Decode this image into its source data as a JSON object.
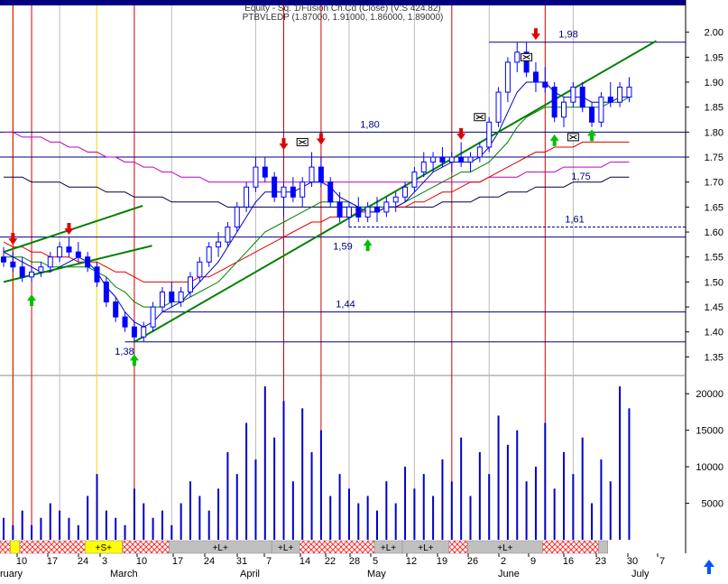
{
  "header": {
    "title_lines": [
      "Equity - Sq. 1/Fusion Ch.Cd (Close) (V:S 424.82)",
      "PTBVLEDP (1.87000, 1.91000, 1.86000, 1.89000)"
    ]
  },
  "chart_data": {
    "type": "candlestick",
    "colors": {
      "up": "#ffffff",
      "down": "#0000ff",
      "outline": "#0000ff",
      "volume": "#0000cc",
      "ma_short": "#0000cc",
      "ma_mid": "#008000",
      "ma_long": "#e00000",
      "ma_200": "#c000c0",
      "ma_300": "#000040",
      "trend": "#008000",
      "level": "#000080",
      "event_line": "#d00000",
      "gray_line": "#bbbbbb",
      "yellow_line": "#ffd000"
    },
    "price_axis": {
      "ticks": [
        "2.00",
        "1.95",
        "1.90",
        "1.85",
        "1.80",
        "1.75",
        "1.70",
        "1.65",
        "1.60",
        "1.55",
        "1.50",
        "1.45",
        "1.40",
        "1.35"
      ],
      "ylim": [
        1.32,
        2.05
      ]
    },
    "volume_axis": {
      "ticks": [
        "20000",
        "15000",
        "10000",
        "5000"
      ],
      "ylim": [
        0,
        22000
      ]
    },
    "x_day_labels": [
      "10",
      "17",
      "24",
      "3",
      "10",
      "17",
      "24",
      "31",
      "7",
      "14",
      "22",
      "28",
      "5",
      "12",
      "19",
      "26",
      "2",
      "9",
      "16",
      "23",
      "30",
      "7"
    ],
    "x_month_labels": [
      "ruary",
      "March",
      "April",
      "May",
      "June",
      "July"
    ],
    "candles": [
      [
        1.55,
        1.57,
        1.53,
        1.54
      ],
      [
        1.54,
        1.56,
        1.52,
        1.53
      ],
      [
        1.53,
        1.55,
        1.5,
        1.51
      ],
      [
        1.51,
        1.53,
        1.5,
        1.52
      ],
      [
        1.52,
        1.54,
        1.51,
        1.53
      ],
      [
        1.53,
        1.56,
        1.52,
        1.55
      ],
      [
        1.55,
        1.58,
        1.54,
        1.57
      ],
      [
        1.57,
        1.59,
        1.55,
        1.56
      ],
      [
        1.56,
        1.58,
        1.54,
        1.55
      ],
      [
        1.55,
        1.56,
        1.52,
        1.53
      ],
      [
        1.53,
        1.54,
        1.49,
        1.5
      ],
      [
        1.5,
        1.51,
        1.45,
        1.46
      ],
      [
        1.46,
        1.47,
        1.42,
        1.43
      ],
      [
        1.43,
        1.44,
        1.4,
        1.41
      ],
      [
        1.41,
        1.42,
        1.38,
        1.39
      ],
      [
        1.39,
        1.42,
        1.38,
        1.41
      ],
      [
        1.41,
        1.46,
        1.4,
        1.45
      ],
      [
        1.45,
        1.49,
        1.44,
        1.48
      ],
      [
        1.48,
        1.5,
        1.45,
        1.46
      ],
      [
        1.46,
        1.49,
        1.45,
        1.48
      ],
      [
        1.48,
        1.52,
        1.47,
        1.51
      ],
      [
        1.51,
        1.55,
        1.5,
        1.54
      ],
      [
        1.54,
        1.58,
        1.53,
        1.57
      ],
      [
        1.57,
        1.6,
        1.55,
        1.58
      ],
      [
        1.58,
        1.62,
        1.57,
        1.61
      ],
      [
        1.61,
        1.66,
        1.6,
        1.65
      ],
      [
        1.65,
        1.7,
        1.64,
        1.69
      ],
      [
        1.69,
        1.75,
        1.68,
        1.73
      ],
      [
        1.73,
        1.75,
        1.7,
        1.71
      ],
      [
        1.71,
        1.72,
        1.66,
        1.67
      ],
      [
        1.67,
        1.7,
        1.63,
        1.69
      ],
      [
        1.69,
        1.71,
        1.66,
        1.67
      ],
      [
        1.67,
        1.71,
        1.65,
        1.7
      ],
      [
        1.7,
        1.76,
        1.69,
        1.73
      ],
      [
        1.73,
        1.75,
        1.69,
        1.7
      ],
      [
        1.7,
        1.71,
        1.65,
        1.66
      ],
      [
        1.66,
        1.68,
        1.62,
        1.63
      ],
      [
        1.63,
        1.66,
        1.61,
        1.65
      ],
      [
        1.65,
        1.67,
        1.62,
        1.63
      ],
      [
        1.63,
        1.66,
        1.62,
        1.65
      ],
      [
        1.65,
        1.67,
        1.62,
        1.64
      ],
      [
        1.64,
        1.67,
        1.63,
        1.66
      ],
      [
        1.66,
        1.68,
        1.64,
        1.67
      ],
      [
        1.67,
        1.7,
        1.66,
        1.69
      ],
      [
        1.69,
        1.73,
        1.68,
        1.72
      ],
      [
        1.72,
        1.76,
        1.71,
        1.74
      ],
      [
        1.74,
        1.76,
        1.72,
        1.75
      ],
      [
        1.75,
        1.77,
        1.73,
        1.74
      ],
      [
        1.74,
        1.76,
        1.72,
        1.75
      ],
      [
        1.75,
        1.78,
        1.73,
        1.74
      ],
      [
        1.74,
        1.76,
        1.72,
        1.75
      ],
      [
        1.75,
        1.78,
        1.74,
        1.77
      ],
      [
        1.77,
        1.83,
        1.76,
        1.82
      ],
      [
        1.82,
        1.89,
        1.81,
        1.88
      ],
      [
        1.88,
        1.95,
        1.86,
        1.94
      ],
      [
        1.94,
        1.98,
        1.92,
        1.96
      ],
      [
        1.96,
        1.98,
        1.91,
        1.92
      ],
      [
        1.92,
        1.94,
        1.88,
        1.9
      ],
      [
        1.9,
        1.93,
        1.88,
        1.89
      ],
      [
        1.89,
        1.9,
        1.82,
        1.83
      ],
      [
        1.83,
        1.87,
        1.81,
        1.86
      ],
      [
        1.86,
        1.9,
        1.85,
        1.89
      ],
      [
        1.89,
        1.9,
        1.84,
        1.85
      ],
      [
        1.85,
        1.86,
        1.81,
        1.82
      ],
      [
        1.82,
        1.88,
        1.81,
        1.87
      ],
      [
        1.87,
        1.9,
        1.85,
        1.86
      ],
      [
        1.86,
        1.9,
        1.85,
        1.89
      ],
      [
        1.87,
        1.91,
        1.86,
        1.89
      ]
    ],
    "volumes": [
      3,
      2,
      4,
      2,
      3,
      5,
      4,
      3,
      2,
      6,
      9,
      4,
      3,
      2,
      7,
      5,
      3,
      4,
      2,
      5,
      8,
      6,
      4,
      7,
      12,
      9,
      16,
      11,
      21,
      14,
      19,
      8,
      18,
      12,
      15,
      6,
      9,
      7,
      5,
      6,
      4,
      8,
      5,
      10,
      7,
      9,
      6,
      11,
      8,
      14,
      6,
      12,
      9,
      17,
      13,
      15,
      8,
      10,
      16,
      7,
      12,
      9,
      14,
      5,
      11,
      8,
      21,
      18
    ],
    "moving_averages": {
      "ma_short": [
        1.56,
        1.55,
        1.54,
        1.53,
        1.52,
        1.52,
        1.53,
        1.54,
        1.55,
        1.54,
        1.52,
        1.49,
        1.47,
        1.44,
        1.42,
        1.41,
        1.42,
        1.44,
        1.45,
        1.46,
        1.48,
        1.5,
        1.52,
        1.54,
        1.57,
        1.6,
        1.63,
        1.66,
        1.68,
        1.68,
        1.68,
        1.68,
        1.69,
        1.7,
        1.7,
        1.69,
        1.67,
        1.66,
        1.65,
        1.64,
        1.64,
        1.65,
        1.65,
        1.66,
        1.68,
        1.7,
        1.72,
        1.73,
        1.74,
        1.74,
        1.74,
        1.75,
        1.77,
        1.8,
        1.84,
        1.88,
        1.9,
        1.9,
        1.9,
        1.88,
        1.87,
        1.87,
        1.87,
        1.86,
        1.86,
        1.86,
        1.87,
        1.87
      ],
      "ma_mid": [
        1.55,
        1.55,
        1.55,
        1.54,
        1.54,
        1.53,
        1.53,
        1.53,
        1.53,
        1.53,
        1.52,
        1.51,
        1.49,
        1.48,
        1.46,
        1.45,
        1.45,
        1.45,
        1.46,
        1.46,
        1.47,
        1.48,
        1.49,
        1.5,
        1.52,
        1.54,
        1.56,
        1.58,
        1.6,
        1.61,
        1.62,
        1.63,
        1.64,
        1.65,
        1.66,
        1.66,
        1.66,
        1.66,
        1.65,
        1.65,
        1.65,
        1.65,
        1.65,
        1.66,
        1.67,
        1.68,
        1.69,
        1.7,
        1.71,
        1.72,
        1.72,
        1.73,
        1.74,
        1.76,
        1.78,
        1.81,
        1.83,
        1.84,
        1.85,
        1.85,
        1.85,
        1.85,
        1.85,
        1.85,
        1.85,
        1.86,
        1.86,
        1.87
      ],
      "ma_long": [
        1.58,
        1.57,
        1.57,
        1.56,
        1.56,
        1.55,
        1.55,
        1.55,
        1.54,
        1.54,
        1.54,
        1.53,
        1.52,
        1.52,
        1.51,
        1.5,
        1.5,
        1.5,
        1.5,
        1.5,
        1.5,
        1.51,
        1.51,
        1.52,
        1.53,
        1.54,
        1.55,
        1.56,
        1.57,
        1.58,
        1.59,
        1.6,
        1.61,
        1.62,
        1.62,
        1.63,
        1.63,
        1.63,
        1.64,
        1.64,
        1.64,
        1.65,
        1.65,
        1.65,
        1.66,
        1.66,
        1.67,
        1.68,
        1.68,
        1.69,
        1.7,
        1.7,
        1.71,
        1.72,
        1.73,
        1.74,
        1.75,
        1.76,
        1.76,
        1.77,
        1.77,
        1.77,
        1.78,
        1.78,
        1.78,
        1.78,
        1.78,
        1.78
      ],
      "ma_200": [
        1.8,
        1.8,
        1.79,
        1.79,
        1.79,
        1.78,
        1.78,
        1.77,
        1.77,
        1.76,
        1.76,
        1.75,
        1.75,
        1.74,
        1.74,
        1.73,
        1.73,
        1.72,
        1.72,
        1.71,
        1.71,
        1.71,
        1.7,
        1.7,
        1.7,
        1.7,
        1.7,
        1.7,
        1.7,
        1.7,
        1.7,
        1.7,
        1.7,
        1.7,
        1.7,
        1.7,
        1.7,
        1.7,
        1.7,
        1.7,
        1.7,
        1.7,
        1.7,
        1.7,
        1.7,
        1.7,
        1.7,
        1.7,
        1.7,
        1.7,
        1.7,
        1.7,
        1.71,
        1.71,
        1.71,
        1.71,
        1.72,
        1.72,
        1.72,
        1.72,
        1.73,
        1.73,
        1.73,
        1.73,
        1.73,
        1.74,
        1.74,
        1.74
      ],
      "ma_300": [
        1.71,
        1.71,
        1.71,
        1.7,
        1.7,
        1.7,
        1.7,
        1.69,
        1.69,
        1.69,
        1.69,
        1.68,
        1.68,
        1.68,
        1.67,
        1.67,
        1.67,
        1.67,
        1.66,
        1.66,
        1.66,
        1.66,
        1.66,
        1.66,
        1.65,
        1.65,
        1.65,
        1.65,
        1.65,
        1.65,
        1.65,
        1.65,
        1.65,
        1.65,
        1.65,
        1.65,
        1.65,
        1.65,
        1.65,
        1.65,
        1.65,
        1.65,
        1.65,
        1.65,
        1.65,
        1.65,
        1.65,
        1.66,
        1.66,
        1.66,
        1.66,
        1.67,
        1.67,
        1.67,
        1.68,
        1.68,
        1.68,
        1.69,
        1.69,
        1.69,
        1.69,
        1.7,
        1.7,
        1.7,
        1.7,
        1.71,
        1.71,
        1.71
      ]
    },
    "horizontal_levels": [
      {
        "value": 1.98,
        "label": "1,98",
        "from_index": 52
      },
      {
        "value": 1.8,
        "label": "1,80",
        "from_index": 0
      },
      {
        "value": 1.75,
        "label": "",
        "from_index": 0
      },
      {
        "value": 1.61,
        "label": "1,61",
        "from_index": 37,
        "dashed": true
      },
      {
        "value": 1.59,
        "label": "1,59",
        "from_index": 0
      },
      {
        "value": 1.44,
        "label": "1,44",
        "from_index": 17
      },
      {
        "value": 1.38,
        "label": "1,38",
        "from_index": 13
      }
    ],
    "level_labels": [
      {
        "label": "1,75",
        "value": 1.75,
        "index": 60
      },
      {
        "label": "1,38",
        "value": 1.38,
        "index": 13
      }
    ],
    "trendlines": [
      {
        "from": [
          14,
          1.38
        ],
        "to": [
          67,
          1.95
        ]
      },
      {
        "from": [
          0,
          1.56
        ],
        "to": [
          12,
          1.62
        ]
      },
      {
        "from": [
          0,
          1.5
        ],
        "to": [
          13,
          1.54
        ]
      }
    ],
    "event_lines_red": [
      1,
      3,
      14,
      30,
      34,
      48,
      58
    ],
    "event_lines_gray": [
      6,
      18,
      27,
      37,
      44,
      52,
      61
    ],
    "event_lines_yellow": [
      0,
      9
    ],
    "signals": [
      {
        "type": "sell",
        "index": 1,
        "price": 1.58
      },
      {
        "type": "sell",
        "index": 7,
        "price": 1.6
      },
      {
        "type": "buy",
        "index": 3,
        "price": 1.47
      },
      {
        "type": "buy",
        "index": 14,
        "price": 1.35
      },
      {
        "type": "sell",
        "index": 30,
        "price": 1.77
      },
      {
        "type": "sell",
        "index": 34,
        "price": 1.78
      },
      {
        "type": "buy",
        "index": 39,
        "price": 1.58
      },
      {
        "type": "sell",
        "index": 49,
        "price": 1.79
      },
      {
        "type": "sell",
        "index": 57,
        "price": 1.99
      },
      {
        "type": "buy",
        "index": 59,
        "price": 1.79
      },
      {
        "type": "buy",
        "index": 63,
        "price": 1.8
      }
    ],
    "boxes": [
      {
        "index": 32,
        "price": 1.78
      },
      {
        "index": 51,
        "price": 1.83
      },
      {
        "index": 56,
        "price": 1.95
      },
      {
        "index": 61,
        "price": 1.79
      }
    ],
    "signal_bar": [
      {
        "label": "",
        "color": "#ff4040",
        "pattern": "hatch",
        "from": 0,
        "to": 1
      },
      {
        "label": "",
        "color": "#ffff00",
        "pattern": "solid",
        "from": 1,
        "to": 2
      },
      {
        "label": "",
        "color": "#ff4040",
        "pattern": "hatch",
        "from": 2,
        "to": 9
      },
      {
        "label": "+S+",
        "color": "#ffff00",
        "pattern": "solid",
        "from": 9,
        "to": 13
      },
      {
        "label": "",
        "color": "#ff4040",
        "pattern": "hatch",
        "from": 13,
        "to": 18
      },
      {
        "label": "+L+",
        "color": "#c0c0c0",
        "pattern": "solid",
        "from": 18,
        "to": 29
      },
      {
        "label": "+L+",
        "color": "#c0c0c0",
        "pattern": "solid",
        "from": 29,
        "to": 32
      },
      {
        "label": "",
        "color": "#ff4040",
        "pattern": "hatch",
        "from": 32,
        "to": 40
      },
      {
        "label": "+L+",
        "color": "#c0c0c0",
        "pattern": "solid",
        "from": 40,
        "to": 43
      },
      {
        "label": "+L+",
        "color": "#c0c0c0",
        "pattern": "solid",
        "from": 43,
        "to": 48
      },
      {
        "label": "",
        "color": "#ff4040",
        "pattern": "hatch",
        "from": 48,
        "to": 50
      },
      {
        "label": "+L+",
        "color": "#c0c0c0",
        "pattern": "solid",
        "from": 50,
        "to": 58
      },
      {
        "label": "",
        "color": "#ff4040",
        "pattern": "hatch",
        "from": 58,
        "to": 64
      },
      {
        "label": "",
        "color": "#c0c0c0",
        "pattern": "solid",
        "from": 64,
        "to": 65
      }
    ]
  },
  "nav": {
    "scroll_up_label": "↑"
  }
}
